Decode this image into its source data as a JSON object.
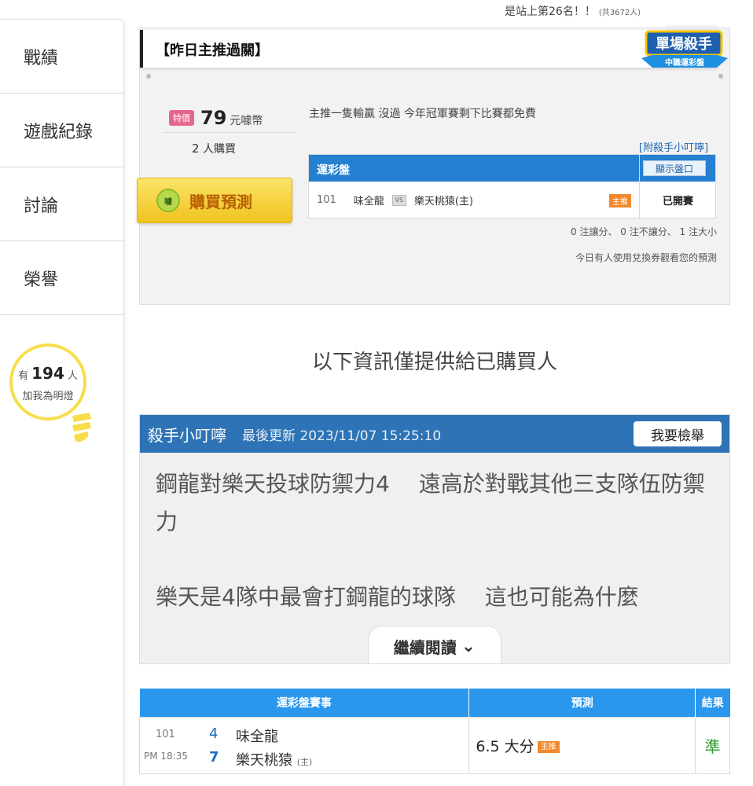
{
  "top": {
    "rank_text": "是站上第26名！！",
    "rank_total": "(共3672人)"
  },
  "sidebar": {
    "items": [
      {
        "label": "戰績"
      },
      {
        "label": "遊戲紀錄"
      },
      {
        "label": "討論"
      },
      {
        "label": "榮譽"
      }
    ],
    "bulb": {
      "prefix": "有",
      "count": "194",
      "suffix": "人",
      "line2": "加我為明燈"
    }
  },
  "panel": {
    "title": "【昨日主推過關】",
    "badge_main": "單場殺手",
    "badge_sub": "中職運彩盤",
    "special_tag": "特價",
    "price": "79",
    "price_unit": "元噱幣",
    "buyers": "2",
    "buyers_unit": "人購買",
    "buy_icon": "噱",
    "buy_label": "購買預測",
    "description": "主推一隻輸贏 沒過 今年冠軍賽剩下比賽都免費",
    "attach_link": "[附殺手小叮嚀]",
    "match": {
      "header": "運彩盤",
      "show_button": "顯示盤口",
      "no": "101",
      "team1": "味全龍",
      "vs": "VS",
      "team2": "樂天桃猿(主)",
      "tag": "主推",
      "status": "已開賽"
    },
    "stat1": "0 注讓分、 0 注不讓分、 1 注大小",
    "stat2": "今日有人使用兌換券觀看您的預測"
  },
  "info_note": "以下資訊僅提供給已購買人",
  "tips": {
    "title": "殺手小叮嚀",
    "update": "最後更新 2023/11/07 15:25:10",
    "report_button": "我要檢舉",
    "para1": "鋼龍對樂天投球防禦力4　 遠高於對戰其他三支隊伍防禦力",
    "para2": "樂天是4隊中最會打鋼龍的球隊　 這也可能為什麼",
    "read_more": "繼續閱讀"
  },
  "result": {
    "headers": {
      "match": "運彩盤賽事",
      "pred": "預測",
      "res": "結果"
    },
    "row": {
      "no": "101",
      "time": "PM 18:35",
      "score1": "4",
      "team1": "味全龍",
      "score2": "7",
      "team2": "樂天桃猿",
      "home": "(主)",
      "prediction": "6.5 大分",
      "tag": "主推",
      "outcome": "準"
    }
  },
  "colors": {
    "accent_blue": "#2680d1",
    "tips_blue": "#2d73b5",
    "table_blue": "#2a96ec",
    "buy_yellow": "#f0c31e",
    "tag_orange": "#f0892c",
    "win_green": "#2a9a2a"
  }
}
